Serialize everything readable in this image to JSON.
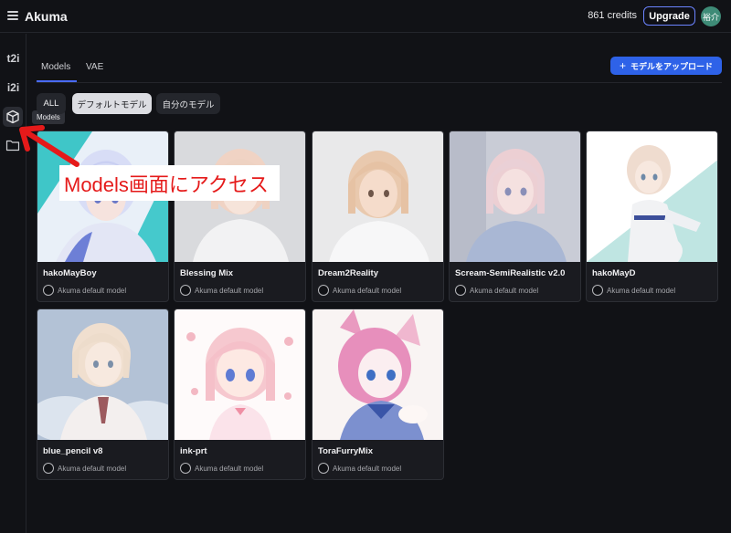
{
  "header": {
    "title": "Akuma",
    "credits": "861 credits",
    "upgrade_label": "Upgrade",
    "avatar_text": "裕介"
  },
  "rail": {
    "t2i": "t2i",
    "i2i": "i2i",
    "tooltip": "Models"
  },
  "tabs": [
    {
      "label": "Models",
      "active": true
    },
    {
      "label": "VAE",
      "active": false
    }
  ],
  "upload_button": {
    "label": "モデルをアップロード"
  },
  "filters": [
    {
      "label": "ALL"
    },
    {
      "label": "デフォルトモデル",
      "selected": true
    },
    {
      "label": "自分のモデル"
    }
  ],
  "models": [
    {
      "name": "hakoMayBoy",
      "subtitle": "Akuma default model"
    },
    {
      "name": "Blessing Mix",
      "subtitle": "Akuma default model"
    },
    {
      "name": "Dream2Reality",
      "subtitle": "Akuma default model"
    },
    {
      "name": "Scream-SemiRealistic v2.0",
      "subtitle": "Akuma default model"
    },
    {
      "name": "hakoMayD",
      "subtitle": "Akuma default model"
    },
    {
      "name": "blue_pencil v8",
      "subtitle": "Akuma default model"
    },
    {
      "name": "ink-prt",
      "subtitle": "Akuma default model"
    },
    {
      "name": "ToraFurryMix",
      "subtitle": "Akuma default model"
    }
  ],
  "annotation": {
    "text": "Models画面にアクセス",
    "color": "#e51a1a"
  },
  "colors": {
    "accent": "#2e62e8",
    "upgrade_border": "#6b83ff",
    "avatar": "#3e8b77"
  }
}
